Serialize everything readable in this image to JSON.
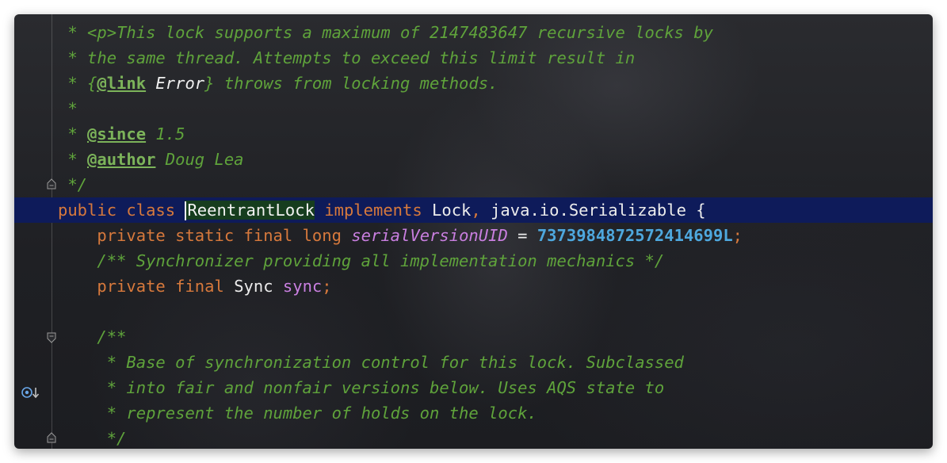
{
  "editor": {
    "language": "Java",
    "icons": {
      "gutter_marker": "override-implementation-marker-icon",
      "fold": "fold-collapse-icon"
    },
    "colors": {
      "comment": "#5fa33b",
      "keyword": "#d7793c",
      "number": "#4ea8de",
      "field": "#c97fe0",
      "current_line": "#0e1b5a",
      "identifier_highlight": "#163d1e"
    },
    "lines": [
      {
        "indent": " ",
        "star": "* ",
        "p_tag": "<p>",
        "text": "This lock supports a maximum of 2147483647 recursive locks by"
      },
      {
        "indent": " ",
        "star": "* ",
        "text": "the same thread. Attempts to exceed this limit result in"
      },
      {
        "indent": " ",
        "star": "* ",
        "brace_open": "{",
        "link_tag": "@link",
        "link_target": " Error",
        "brace_close": "}",
        "text": " throws from locking methods."
      },
      {
        "indent": " ",
        "star": "*"
      },
      {
        "indent": " ",
        "star": "* ",
        "tag": "@since",
        "text": " 1.5"
      },
      {
        "indent": " ",
        "star": "* ",
        "tag": "@author",
        "text": " Doug Lea"
      },
      {
        "indent": " ",
        "end": "*/"
      },
      {
        "kw_public": "public",
        "kw_class": "class",
        "class_name": "ReentrantLock",
        "kw_implements": "implements",
        "type_lock": "Lock",
        "comma": ",",
        "type_serializable": "java.io.Serializable",
        "brace": "{"
      },
      {
        "indent": "    ",
        "kw_private": "private",
        "kw_static": "static",
        "kw_final": "final",
        "kw_long": "long",
        "field": "serialVersionUID",
        "eq": " = ",
        "number": "7373984872572414699L",
        "semi": ";"
      },
      {
        "indent": "    ",
        "text": "/** Synchronizer providing all implementation mechanics */"
      },
      {
        "indent": "    ",
        "kw_private": "private",
        "kw_final": "final",
        "type": "Sync",
        "field": "sync",
        "semi": ";"
      },
      {
        "indent": ""
      },
      {
        "indent": "    ",
        "text": "/**"
      },
      {
        "indent": "     ",
        "text": "* Base of synchronization control for this lock. Subclassed"
      },
      {
        "indent": "     ",
        "text": "* into fair and nonfair versions below. Uses AQS state to"
      },
      {
        "indent": "     ",
        "text": "* represent the number of holds on the lock."
      },
      {
        "indent": "     ",
        "text": "*/"
      }
    ]
  }
}
